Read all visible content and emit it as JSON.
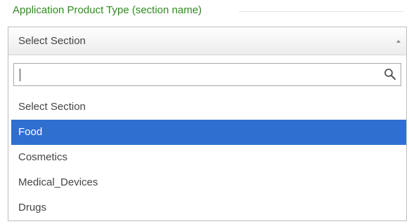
{
  "field": {
    "label": "Application Product Type (section name)"
  },
  "select": {
    "current_value": "Select Section"
  },
  "search": {
    "value": "",
    "placeholder": ""
  },
  "options": [
    {
      "label": "Select Section",
      "selected": false
    },
    {
      "label": "Food",
      "selected": true
    },
    {
      "label": "Cosmetics",
      "selected": false
    },
    {
      "label": "Medical_Devices",
      "selected": false
    },
    {
      "label": "Drugs",
      "selected": false
    }
  ],
  "colors": {
    "label_green": "#2f8b1f",
    "highlight_blue": "#2f6fd0"
  },
  "icons": {
    "search": "search-icon",
    "caret": "caret-up-icon"
  }
}
